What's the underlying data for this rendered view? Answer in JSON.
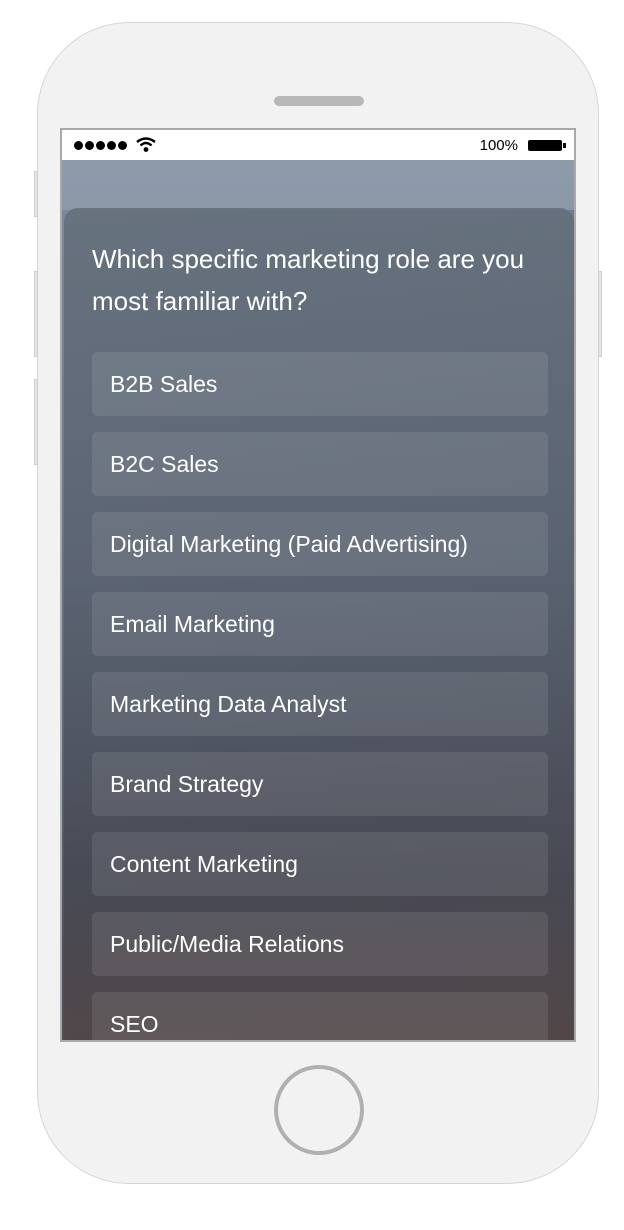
{
  "status_bar": {
    "signal_icon": "signal-dots-icon",
    "wifi_icon": "wifi-icon",
    "battery_percent": "100%",
    "battery_icon": "battery-full-icon"
  },
  "survey": {
    "question": "Which specific marketing role are you most familiar with?",
    "options": [
      "B2B Sales",
      "B2C Sales",
      "Digital Marketing (Paid Advertising)",
      "Email Marketing",
      "Marketing Data Analyst",
      "Brand Strategy",
      "Content Marketing",
      "Public/Media Relations",
      "SEO"
    ]
  },
  "colors": {
    "phone_body": "#f2f2f2",
    "text": "#ffffff",
    "option_bg": "rgba(255,255,255,0.09)"
  }
}
